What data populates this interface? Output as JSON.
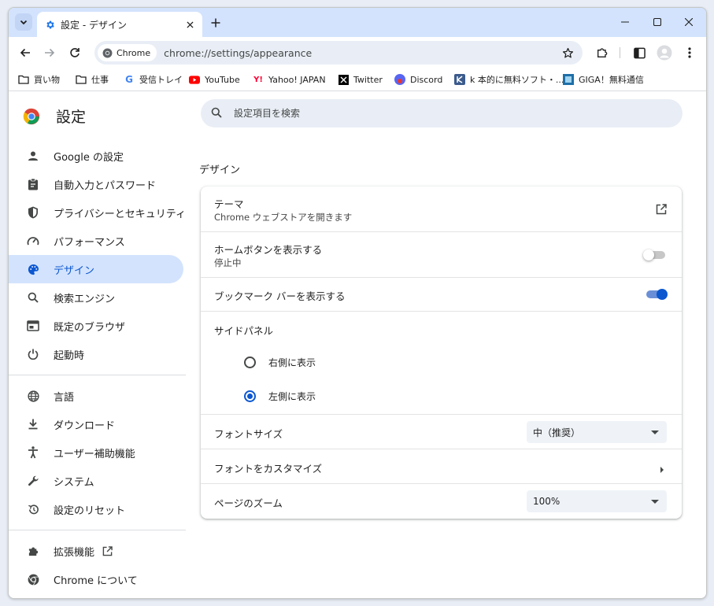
{
  "tab": {
    "title": "設定 - デザイン"
  },
  "omnibox": {
    "chip_label": "Chrome",
    "url": "chrome://settings/appearance"
  },
  "bookmarks": [
    {
      "label": "買い物",
      "icon": "folder-icon"
    },
    {
      "label": "仕事",
      "icon": "folder-icon"
    },
    {
      "label": "受信トレイ",
      "icon": "google-icon"
    },
    {
      "label": "YouTube",
      "icon": "youtube-icon"
    },
    {
      "label": "Yahoo! JAPAN",
      "icon": "yahoo-icon"
    },
    {
      "label": "Twitter",
      "icon": "x-icon"
    },
    {
      "label": "Discord",
      "icon": "discord-icon"
    },
    {
      "label": "k 本的に無料ソフト・...",
      "icon": "k-icon"
    },
    {
      "label": "GIGA！無料通信",
      "icon": "giga-icon"
    }
  ],
  "sidebar": {
    "title": "設定",
    "items": [
      {
        "label": "Google の設定",
        "icon": "person-icon"
      },
      {
        "label": "自動入力とパスワード",
        "icon": "clipboard-icon"
      },
      {
        "label": "プライバシーとセキュリティ",
        "icon": "shield-icon"
      },
      {
        "label": "パフォーマンス",
        "icon": "speedometer-icon"
      },
      {
        "label": "デザイン",
        "icon": "palette-icon",
        "active": true
      },
      {
        "label": "検索エンジン",
        "icon": "search-icon"
      },
      {
        "label": "既定のブラウザ",
        "icon": "browser-icon"
      },
      {
        "label": "起動時",
        "icon": "power-icon"
      }
    ],
    "items2": [
      {
        "label": "言語",
        "icon": "globe-icon"
      },
      {
        "label": "ダウンロード",
        "icon": "download-icon"
      },
      {
        "label": "ユーザー補助機能",
        "icon": "accessibility-icon"
      },
      {
        "label": "システム",
        "icon": "wrench-icon"
      },
      {
        "label": "設定のリセット",
        "icon": "reset-icon"
      }
    ],
    "items3": [
      {
        "label": "拡張機能",
        "icon": "puzzle-icon"
      },
      {
        "label": "Chrome について",
        "icon": "chrome-icon"
      }
    ]
  },
  "search": {
    "placeholder": "設定項目を検索"
  },
  "main": {
    "section_title": "デザイン",
    "theme": {
      "label": "テーマ",
      "sub": "Chrome ウェブストアを開きます"
    },
    "home_button": {
      "label": "ホームボタンを表示する",
      "sub": "停止中",
      "on": false
    },
    "bookmark_bar": {
      "label": "ブックマーク バーを表示する",
      "on": true
    },
    "side_panel": {
      "label": "サイドパネル",
      "options": [
        {
          "label": "右側に表示",
          "selected": false
        },
        {
          "label": "左側に表示",
          "selected": true
        }
      ]
    },
    "font_size": {
      "label": "フォントサイズ",
      "value": "中（推奨）"
    },
    "customize_fonts": {
      "label": "フォントをカスタマイズ"
    },
    "page_zoom": {
      "label": "ページのズーム",
      "value": "100%"
    }
  },
  "colors": {
    "accent": "#0b57d0",
    "active_bg": "#d3e3fd",
    "tabstrip": "#d3e3fd"
  }
}
